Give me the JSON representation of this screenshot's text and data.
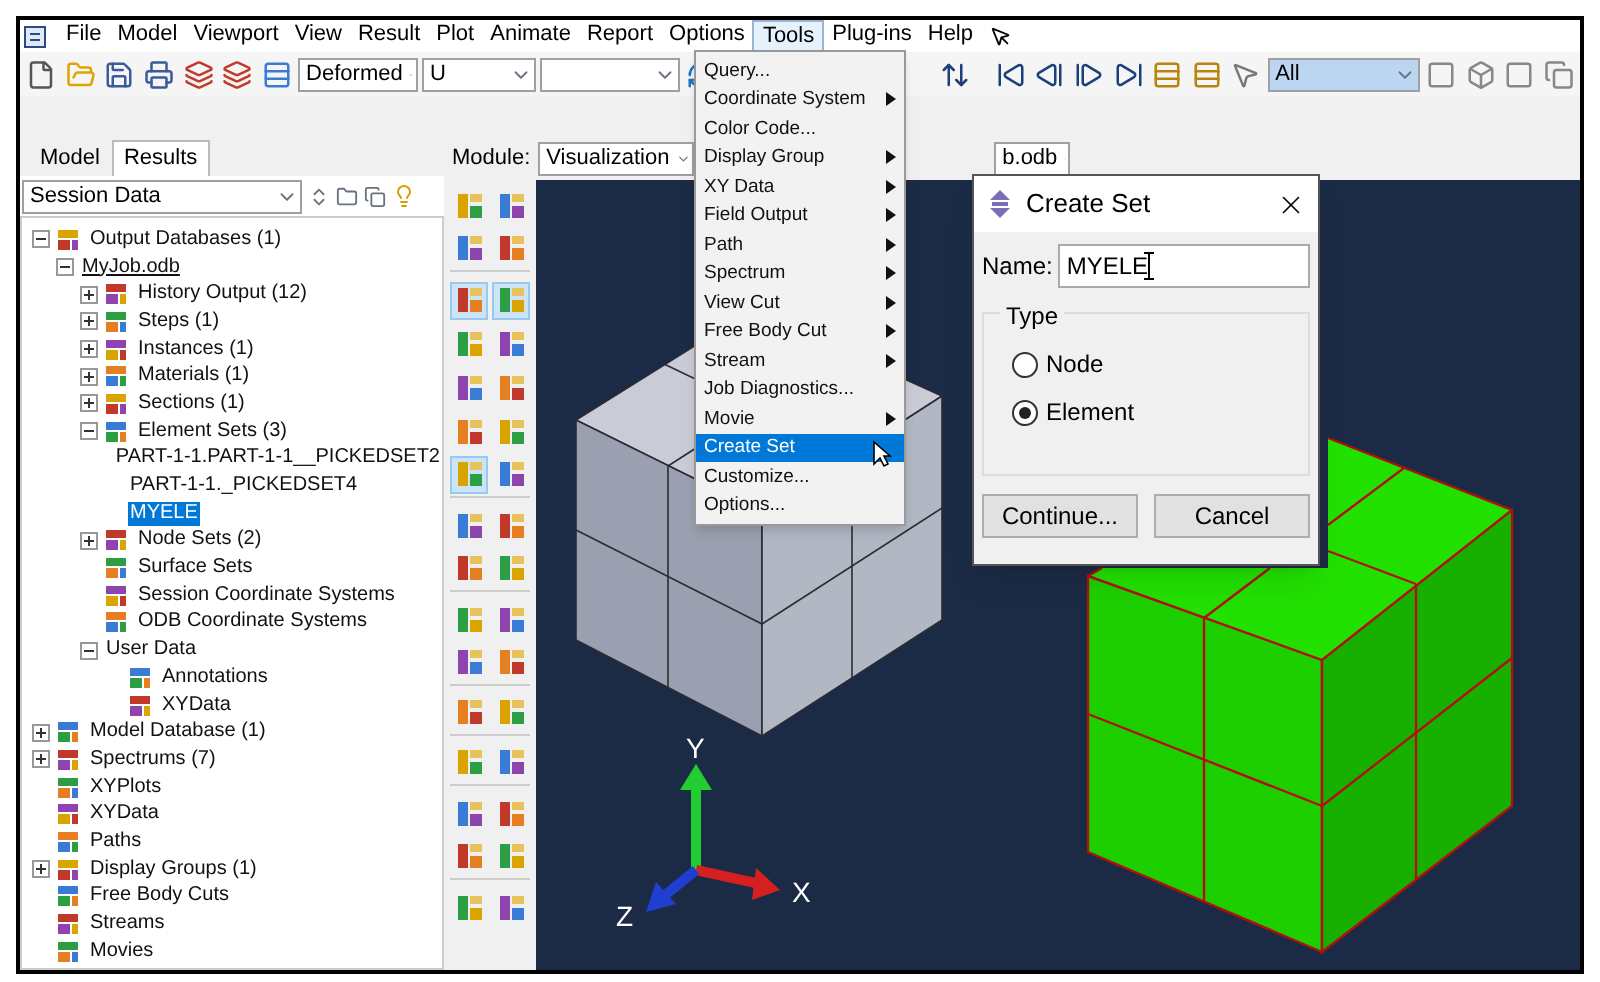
{
  "menu_bar": [
    {
      "label": "File",
      "selected": false
    },
    {
      "label": "Model",
      "selected": false
    },
    {
      "label": "Viewport",
      "selected": false
    },
    {
      "label": "View",
      "selected": false
    },
    {
      "label": "Result",
      "selected": false
    },
    {
      "label": "Plot",
      "selected": false
    },
    {
      "label": "Animate",
      "selected": false
    },
    {
      "label": "Report",
      "selected": false
    },
    {
      "label": "Options",
      "selected": false
    },
    {
      "label": "Tools",
      "selected": true
    },
    {
      "label": "Plug-ins",
      "selected": false
    },
    {
      "label": "Help",
      "selected": false
    }
  ],
  "toolbar": {
    "plot_state": "Deformed",
    "variable": "U",
    "selection_filter": "All"
  },
  "tabs": [
    {
      "label": "Model",
      "selected": false
    },
    {
      "label": "Results",
      "selected": true
    }
  ],
  "module": {
    "label": "Module:",
    "value": "Visualization"
  },
  "model_combo": "b.odb",
  "session_combo": "Session Data",
  "tree": [
    {
      "label": "Output Databases (1)",
      "expandable": true,
      "expanded": true,
      "has_icon": true,
      "selected": false,
      "underlined": false,
      "children": [
        {
          "label": "MyJob.odb",
          "expandable": true,
          "expanded": true,
          "has_icon": false,
          "selected": false,
          "underlined": true,
          "children": [
            {
              "label": "History Output (12)",
              "expandable": true,
              "expanded": false,
              "has_icon": true,
              "selected": false,
              "underlined": false
            },
            {
              "label": "Steps (1)",
              "expandable": true,
              "expanded": false,
              "has_icon": true,
              "selected": false,
              "underlined": false
            },
            {
              "label": "Instances (1)",
              "expandable": true,
              "expanded": false,
              "has_icon": true,
              "selected": false,
              "underlined": false
            },
            {
              "label": "Materials (1)",
              "expandable": true,
              "expanded": false,
              "has_icon": true,
              "selected": false,
              "underlined": false
            },
            {
              "label": "Sections (1)",
              "expandable": true,
              "expanded": false,
              "has_icon": true,
              "selected": false,
              "underlined": false
            },
            {
              "label": "Element Sets (3)",
              "expandable": true,
              "expanded": true,
              "has_icon": true,
              "selected": false,
              "underlined": false,
              "children": [
                {
                  "label": "PART-1-1.PART-1-1__PICKEDSET2",
                  "expandable": false,
                  "has_icon": false,
                  "selected": false,
                  "underlined": false
                },
                {
                  "label": "PART-1-1._PICKEDSET4",
                  "expandable": false,
                  "has_icon": false,
                  "selected": false,
                  "underlined": false
                },
                {
                  "label": "MYELE",
                  "expandable": false,
                  "has_icon": false,
                  "selected": true,
                  "underlined": false
                }
              ]
            },
            {
              "label": "Node Sets (2)",
              "expandable": true,
              "expanded": false,
              "has_icon": true,
              "selected": false,
              "underlined": false
            },
            {
              "label": "Surface Sets",
              "expandable": false,
              "has_icon": true,
              "selected": false,
              "underlined": false
            },
            {
              "label": "Session Coordinate Systems",
              "expandable": false,
              "has_icon": true,
              "selected": false,
              "underlined": false
            },
            {
              "label": "ODB Coordinate Systems",
              "expandable": false,
              "has_icon": true,
              "selected": false,
              "underlined": false
            },
            {
              "label": "User Data",
              "expandable": true,
              "expanded": true,
              "has_icon": false,
              "selected": false,
              "underlined": false,
              "children": [
                {
                  "label": "Annotations",
                  "expandable": false,
                  "has_icon": true,
                  "selected": false,
                  "underlined": false
                },
                {
                  "label": "XYData",
                  "expandable": false,
                  "has_icon": true,
                  "selected": false,
                  "underlined": false
                }
              ]
            }
          ]
        }
      ]
    },
    {
      "label": "Model Database (1)",
      "expandable": true,
      "expanded": false,
      "has_icon": true,
      "selected": false,
      "underlined": false
    },
    {
      "label": "Spectrums (7)",
      "expandable": true,
      "expanded": false,
      "has_icon": true,
      "selected": false,
      "underlined": false
    },
    {
      "label": "XYPlots",
      "expandable": false,
      "has_icon": true,
      "selected": false,
      "underlined": false
    },
    {
      "label": "XYData",
      "expandable": false,
      "has_icon": true,
      "selected": false,
      "underlined": false
    },
    {
      "label": "Paths",
      "expandable": false,
      "has_icon": true,
      "selected": false,
      "underlined": false
    },
    {
      "label": "Display Groups (1)",
      "expandable": true,
      "expanded": false,
      "has_icon": true,
      "selected": false,
      "underlined": false
    },
    {
      "label": "Free Body Cuts",
      "expandable": false,
      "has_icon": true,
      "selected": false,
      "underlined": false
    },
    {
      "label": "Streams",
      "expandable": false,
      "has_icon": true,
      "selected": false,
      "underlined": false
    },
    {
      "label": "Movies",
      "expandable": false,
      "has_icon": true,
      "selected": false,
      "underlined": false
    }
  ],
  "toolbox": [
    [
      {
        "pressed": false
      },
      {
        "pressed": false
      }
    ],
    [
      {
        "pressed": false
      },
      {
        "pressed": false
      }
    ],
    [
      {
        "pressed": true
      },
      {
        "pressed": true
      }
    ],
    [
      {
        "pressed": false
      },
      {
        "pressed": false
      }
    ],
    [
      {
        "pressed": false
      },
      {
        "pressed": false
      }
    ],
    [
      {
        "pressed": false
      },
      {
        "pressed": false
      }
    ],
    [
      {
        "pressed": true
      },
      {
        "pressed": false
      }
    ],
    [
      {
        "pressed": false
      },
      {
        "pressed": false
      }
    ],
    [
      {
        "pressed": false
      },
      {
        "pressed": false
      }
    ],
    [
      {
        "pressed": false
      },
      {
        "pressed": false
      }
    ],
    [
      {
        "pressed": false
      },
      {
        "pressed": false
      }
    ],
    [
      {
        "pressed": false
      },
      {
        "pressed": false
      }
    ],
    [
      {
        "pressed": false
      },
      {
        "pressed": false
      }
    ],
    [
      {
        "pressed": false
      },
      {
        "pressed": false
      }
    ],
    [
      {
        "pressed": false
      },
      {
        "pressed": false
      }
    ],
    [
      {
        "pressed": false
      },
      {
        "pressed": false
      }
    ]
  ],
  "tools_menu": [
    {
      "label": "Query...",
      "submenu": false,
      "selected": false
    },
    {
      "label": "Coordinate System",
      "submenu": true,
      "selected": false
    },
    {
      "label": "Color Code...",
      "submenu": false,
      "selected": false
    },
    {
      "label": "Display Group",
      "submenu": true,
      "selected": false
    },
    {
      "label": "XY Data",
      "submenu": true,
      "selected": false
    },
    {
      "label": "Field Output",
      "submenu": true,
      "selected": false
    },
    {
      "label": "Path",
      "submenu": true,
      "selected": false
    },
    {
      "label": "Spectrum",
      "submenu": true,
      "selected": false
    },
    {
      "label": "View Cut",
      "submenu": true,
      "selected": false
    },
    {
      "label": "Free Body Cut",
      "submenu": true,
      "selected": false
    },
    {
      "label": "Stream",
      "submenu": true,
      "selected": false
    },
    {
      "label": "Job Diagnostics...",
      "submenu": false,
      "selected": false
    },
    {
      "label": "Movie",
      "submenu": true,
      "selected": false
    },
    {
      "label": "Create Set",
      "submenu": false,
      "selected": true
    },
    {
      "label": "Customize...",
      "submenu": false,
      "selected": false
    },
    {
      "label": "Options...",
      "submenu": false,
      "selected": false
    }
  ],
  "dialog": {
    "title": "Create Set",
    "name_label": "Name:",
    "name_value": "MYELE",
    "group_title": "Type",
    "type_options": [
      {
        "label": "Node",
        "selected": false
      },
      {
        "label": "Element",
        "selected": true
      }
    ],
    "buttons": [
      "Continue...",
      "Cancel"
    ]
  },
  "triad": {
    "y": "Y",
    "x": "X",
    "z": "Z"
  }
}
